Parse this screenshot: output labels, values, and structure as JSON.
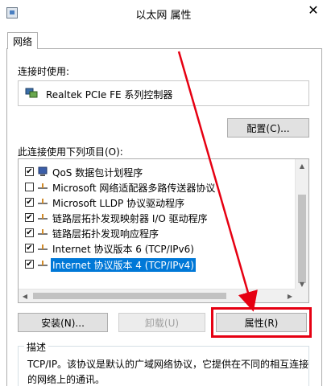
{
  "window": {
    "title": "以太网 属性",
    "close_glyph": "✕"
  },
  "tabs": [
    {
      "label": "网络"
    }
  ],
  "connect_using": {
    "label": "连接时使用:",
    "adapter_name": "Realtek PCIe FE 系列控制器",
    "configure_button": "配置(C)..."
  },
  "items_section": {
    "label": "此连接使用下列项目(O):",
    "items": [
      {
        "label": "QoS 数据包计划程序",
        "checked": true
      },
      {
        "label": "Microsoft 网络适配器多路传送器协议",
        "checked": false
      },
      {
        "label": "Microsoft LLDP 协议驱动程序",
        "checked": true
      },
      {
        "label": "链路层拓扑发现映射器 I/O 驱动程序",
        "checked": true
      },
      {
        "label": "链路层拓扑发现响应程序",
        "checked": true
      },
      {
        "label": "Internet 协议版本 6 (TCP/IPv6)",
        "checked": true
      },
      {
        "label": "Internet 协议版本 4 (TCP/IPv4)",
        "checked": true,
        "selected": true
      }
    ]
  },
  "buttons": {
    "install": "安装(N)...",
    "uninstall": "卸载(U)",
    "properties": "属性(R)"
  },
  "description": {
    "title": "描述",
    "text": "TCP/IP。该协议是默认的广域网络协议，它提供在不同的相互连接的网络上的通讯。"
  },
  "colors": {
    "selection": "#0078d7",
    "annotation": "#e60012"
  }
}
